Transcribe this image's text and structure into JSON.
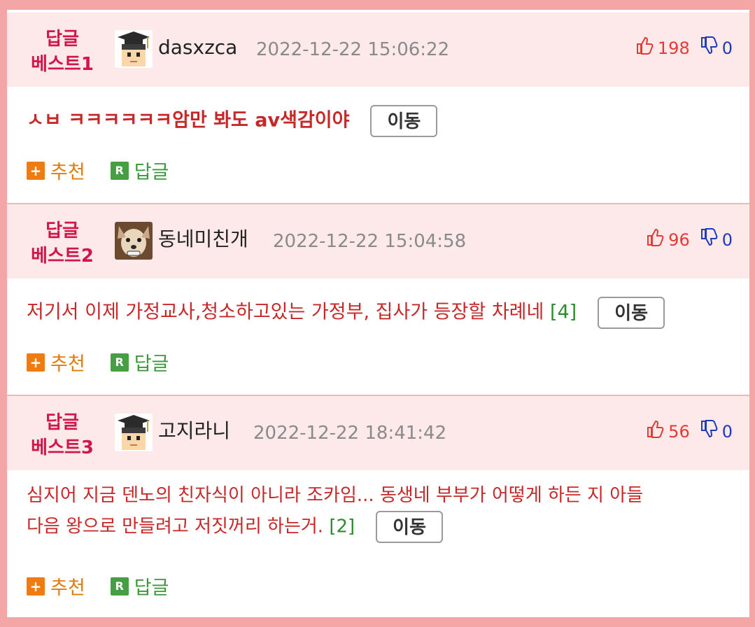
{
  "move_label": "이동",
  "actions": {
    "recommend_label": "추천",
    "reply_label": "답글",
    "recommend_icon": "+",
    "reply_icon": "R"
  },
  "colors": {
    "frame": "#f4a6a6",
    "header_bg": "#fde9e9",
    "best_label": "#d1164a",
    "content": "#c62828",
    "up": "#e53935",
    "down": "#1e3ab8"
  },
  "comments": [
    {
      "best_line1": "답글",
      "best_line2": "베스트1",
      "avatar_icon": "graduate-avatar-icon",
      "username": "dasxzca",
      "date": "2022-12-22 15:06:22",
      "up": "198",
      "down": "0",
      "text": "ㅅㅂ ㅋㅋㅋㅋㅋㅋ암만 봐도 av색감이야",
      "reply_count": ""
    },
    {
      "best_line1": "답글",
      "best_line2": "베스트2",
      "avatar_icon": "dog-photo-avatar",
      "username": "동네미친개",
      "date": "2022-12-22 15:04:58",
      "up": "96",
      "down": "0",
      "text": "저기서 이제 가정교사,청소하고있는 가정부, 집사가 등장할 차례네",
      "reply_count": "[4]"
    },
    {
      "best_line1": "답글",
      "best_line2": "베스트3",
      "avatar_icon": "graduate-avatar-icon",
      "username": "고지라니",
      "date": "2022-12-22 18:41:42",
      "up": "56",
      "down": "0",
      "text_line1": "심지어 지금 덴노의 친자식이 아니라 조카임... 동생네 부부가 어떻게 하든 지 아들",
      "text_line2": "다음 왕으로 만들려고 저짓꺼리 하는거.",
      "reply_count": "[2]"
    }
  ]
}
